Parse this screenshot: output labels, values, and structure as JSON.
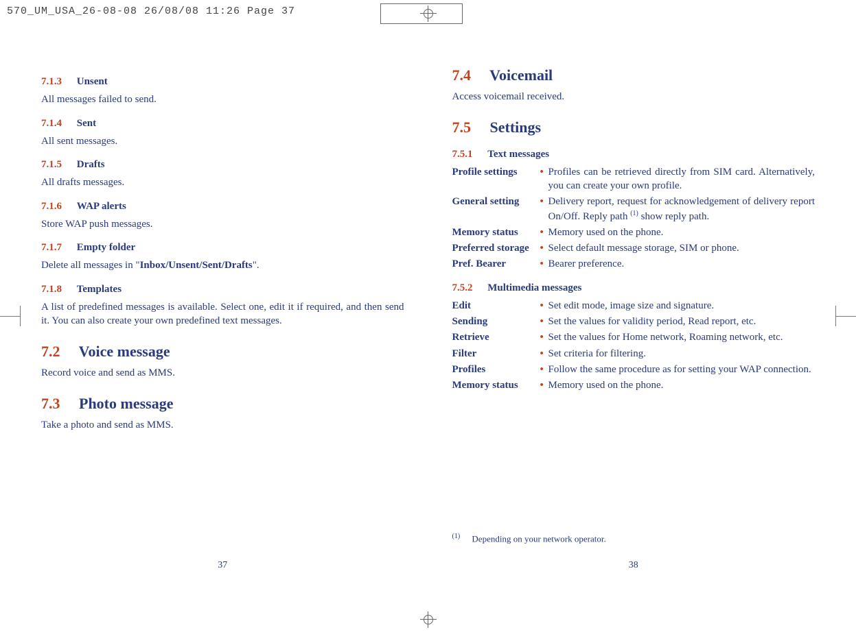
{
  "print_header": "570_UM_USA_26-08-08  26/08/08  11:26  Page 37",
  "left": {
    "sections": [
      {
        "num": "7.1.3",
        "title": "Unsent",
        "body": "All messages failed to send."
      },
      {
        "num": "7.1.4",
        "title": "Sent",
        "body": "All sent messages."
      },
      {
        "num": "7.1.5",
        "title": "Drafts",
        "body": "All drafts messages."
      },
      {
        "num": "7.1.6",
        "title": "WAP alerts",
        "body": "Store WAP push messages."
      },
      {
        "num": "7.1.7",
        "title": "Empty folder",
        "body_pre": "Delete all messages in \"",
        "body_bold": "Inbox/Unsent/Sent/Drafts",
        "body_post": "\"."
      },
      {
        "num": "7.1.8",
        "title": "Templates",
        "body": "A list of predefined messages is available. Select one, edit it if required, and then send it. You can also create your own predefined text messages."
      }
    ],
    "h2a": {
      "num": "7.2",
      "title": "Voice message",
      "body": "Record voice and send as MMS."
    },
    "h2b": {
      "num": "7.3",
      "title": "Photo message",
      "body": "Take a photo and send as MMS."
    },
    "page_num": "37"
  },
  "right": {
    "h2a": {
      "num": "7.4",
      "title": "Voicemail",
      "body": "Access voicemail received."
    },
    "h2b": {
      "num": "7.5",
      "title": "Settings"
    },
    "s751": {
      "num": "7.5.1",
      "title": "Text messages"
    },
    "text_rows": [
      {
        "term": "Profile settings",
        "desc": "Profiles can be retrieved directly from SIM card. Alternatively, you can create your own profile."
      },
      {
        "term": "General setting",
        "desc_pre": "Delivery report, request for acknowledgement of delivery report On/Off. Reply path ",
        "desc_sup": "(1)",
        "desc_post": " show reply path."
      },
      {
        "term": "Memory status",
        "desc": "Memory used on the phone."
      },
      {
        "term": "Preferred storage",
        "desc": "Select default message storage, SIM or phone."
      },
      {
        "term": "Pref. Bearer",
        "desc": "Bearer preference."
      }
    ],
    "s752": {
      "num": "7.5.2",
      "title": "Multimedia messages"
    },
    "mm_rows": [
      {
        "term": "Edit",
        "desc": "Set edit mode, image size and signature."
      },
      {
        "term": "Sending",
        "desc": "Set the values for validity period, Read report, etc."
      },
      {
        "term": "Retrieve",
        "desc": "Set the values for Home network, Roaming network, etc."
      },
      {
        "term": "Filter",
        "desc": "Set criteria for filtering."
      },
      {
        "term": "Profiles",
        "desc": "Follow the same procedure as for setting your WAP connection."
      },
      {
        "term": "Memory status",
        "desc": "Memory used on the phone."
      }
    ],
    "footnote_mark": "(1)",
    "footnote_text": "Depending on your network operator.",
    "page_num": "38"
  }
}
